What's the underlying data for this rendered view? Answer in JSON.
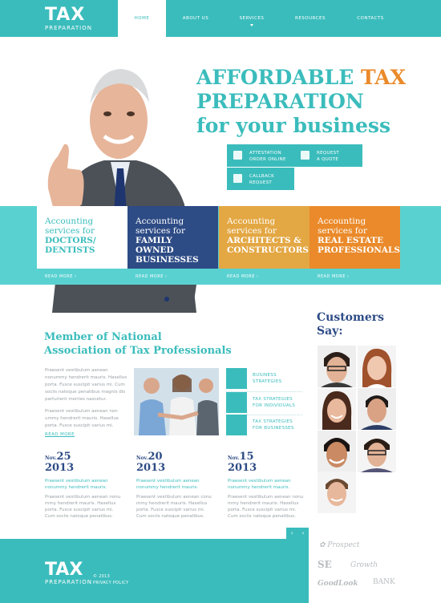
{
  "header": {
    "logo_big": "TAX",
    "logo_small": "PREPARATION",
    "nav": [
      "HOME",
      "ABOUT US",
      "SERVICES",
      "RESOURCES",
      "CONTACTS"
    ]
  },
  "hero": {
    "title_line1_a": "AFFORDABLE ",
    "title_line1_b": "TAX",
    "title_line2": "PREPARATION",
    "title_line3": "for your business",
    "buttons": [
      {
        "line1": "ATTESTATION",
        "line2": "ORDER ONLINE",
        "icon": "document-icon"
      },
      {
        "line1": "REQUEST",
        "line2": "A QUOTE",
        "icon": "bag-icon"
      },
      {
        "line1": "CALLBACK",
        "line2": "REQUEST",
        "icon": "phone-icon"
      }
    ]
  },
  "services": [
    {
      "line1": "Accounting",
      "line2": "services for",
      "line3": "DOCTORS/",
      "line4": "DENTISTS",
      "read_more": "READ MORE"
    },
    {
      "line1": "Accounting",
      "line2": "services for",
      "line3": "FAMILY OWNED",
      "line4": "BUSINESSES",
      "read_more": "READ MORE"
    },
    {
      "line1": "Accounting",
      "line2": "services for",
      "line3": "ARCHITECTS &",
      "line4": "CONSTRUCTORS",
      "read_more": "READ MORE"
    },
    {
      "line1": "Accounting",
      "line2": "services for",
      "line3": "REAL ESTATE",
      "line4": "PROFESSIONALS",
      "read_more": "READ MORE"
    }
  ],
  "member": {
    "title_line1": "Member of National",
    "title_line2": "Association of Tax Professionals",
    "para1": [
      "Praesent vestibulum aenean",
      "nonummy hendrerit mauris. Hasellus",
      "porta. Fusce suscipit varius mi. Cum",
      "sociis natoque penatibus magnis dis",
      "parturient montes nascetur."
    ],
    "para2": [
      "Praesent vestibulum aenean non",
      "ummy hendrerit mauris. Hasellus",
      "porta. Fusce suscipit varius mi."
    ],
    "read_more": "READ MORE"
  },
  "features": [
    {
      "line1": "BUSINESS",
      "line2": "STRATEGIES"
    },
    {
      "line1": "TAX STRATEGIES",
      "line2": "FOR INDIVIDUALS"
    },
    {
      "line1": "TAX STRATEGIES",
      "line2": "FOR BUSINESSES"
    }
  ],
  "news": [
    {
      "month": "Nov.",
      "day": "25",
      "year": "2013",
      "lead": [
        "Praesent vestibulum aenean",
        "nonummy hendrerit mauris."
      ],
      "body": [
        "Praesent vestibulum aenean nonu",
        "mmy hendrerit mauris. Hasellus",
        "porta. Fusce suscipit varius mi.",
        "Cum sociis natoque penatibus."
      ]
    },
    {
      "month": "Nov.",
      "day": "20",
      "year": "2013",
      "lead": [
        "Praesent vestibulum aenean",
        "nonummy hendrerit mauris."
      ],
      "body": [
        "Praesent vestibulum aenean conu",
        "mmy hendrerit mauris. Hasellus",
        "porta. Fusce suscipit varius mi.",
        "Cum sociis natoque penatibus."
      ]
    },
    {
      "month": "Nov.",
      "day": "15",
      "year": "2013",
      "lead": [
        "Praesent vestibulum aenean",
        "nonummy hendrerit mauris."
      ],
      "body": [
        "Praesent vestibulum aenean nonu",
        "mmy hendrerit mauris. Hasellus",
        "porta. Fusce suscipit varius mi.",
        "Cum sociis natoque penatibus."
      ]
    }
  ],
  "pager": {
    "prev": "‹",
    "next": "›"
  },
  "customers": {
    "title_line1": "Customers",
    "title_line2": "Say:"
  },
  "footer": {
    "logo_big": "TAX",
    "logo_small": "PREPARATION",
    "copyright": "© 2013",
    "privacy": "PRIVACY POLICY"
  },
  "partners": [
    "Prospect",
    "SE",
    "Growth",
    "GoodLook",
    "BANK"
  ],
  "colors": {
    "teal": "#3bbcbc",
    "light_teal": "#5ad1d1",
    "navy": "#2d4b85",
    "orange": "#ea8a2a",
    "gold": "#e3a743",
    "white": "#ffffff"
  }
}
